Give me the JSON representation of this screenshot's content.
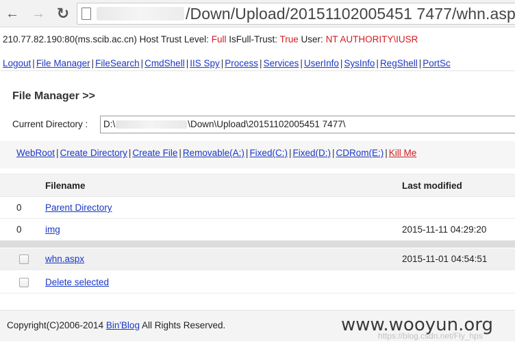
{
  "browser": {
    "url_path": "/Down/Upload/20151102005451 7477/whn.aspx"
  },
  "info": {
    "host": "210.77.82.190:80(ms.scib.ac.cn)",
    "trust_label": "Host Trust Level:",
    "trust_value": "Full",
    "fulltrust_label": "IsFull-Trust:",
    "fulltrust_value": "True",
    "user_label": "User:",
    "user_value": "NT AUTHORITY\\IUSR"
  },
  "nav_links": [
    "Logout",
    "File Manager",
    "FileSearch",
    "CmdShell",
    "IIS Spy",
    "Process",
    "Services",
    "UserInfo",
    "SysInfo",
    "RegShell",
    "PortSc"
  ],
  "file_manager": {
    "title": "File Manager >>",
    "current_dir_label": "Current Directory :",
    "current_dir_prefix": "D:\\",
    "current_dir_suffix": "\\Down\\Upload\\20151102005451 7477\\"
  },
  "drive_links": [
    "WebRoot",
    "Create Directory",
    "Create File",
    "Removable(A:)",
    "Fixed(C:)",
    "Fixed(D:)",
    "CDRom(E:)"
  ],
  "kill_me": "Kill Me",
  "table": {
    "header_filename": "Filename",
    "header_modified": "Last modified",
    "rows": [
      {
        "num": "0",
        "name": "Parent Directory",
        "date": ""
      },
      {
        "num": "0",
        "name": "img",
        "date": "2015-11-11 04:29:20"
      },
      {
        "num": "",
        "name": "whn.aspx",
        "date": "2015-11-01 04:54:51"
      }
    ],
    "delete_label": "Delete selected"
  },
  "footer": {
    "copyright_prefix": "Copyright(C)2006-2014",
    "bin_blog": "Bin'Blog",
    "rights": "All Rights Reserved."
  },
  "watermark": "www.wooyun.org",
  "watermark_sub": "https://blog.csdn.net/Fly_hps"
}
